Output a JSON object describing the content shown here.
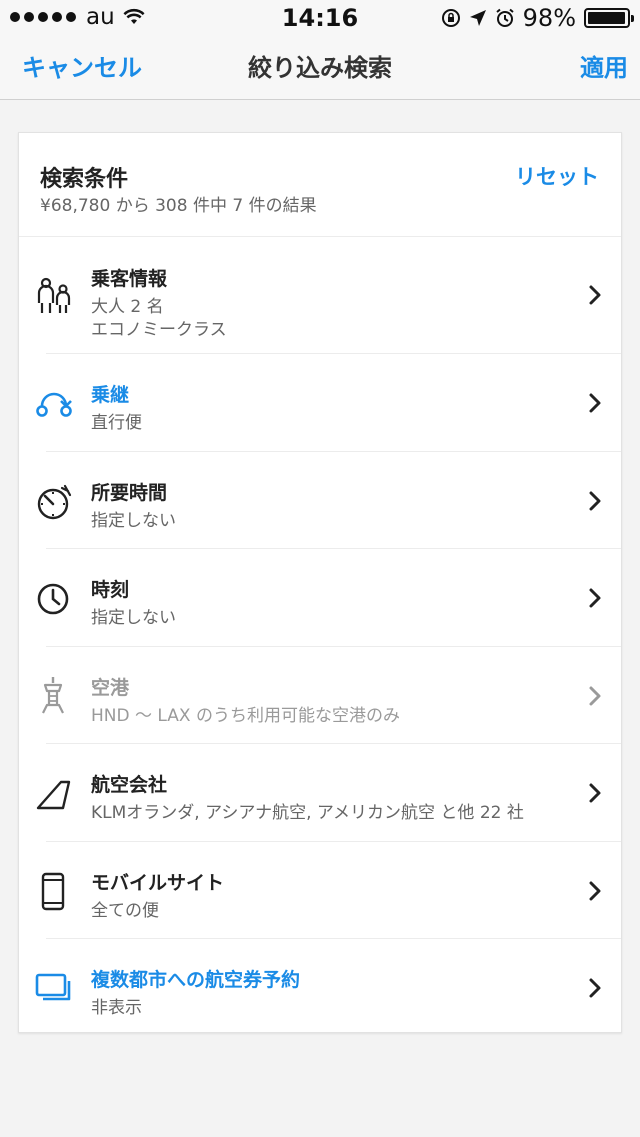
{
  "status_bar": {
    "carrier": "au",
    "time": "14:16",
    "battery": "98%",
    "battery_level": 0.98
  },
  "nav": {
    "cancel": "キャンセル",
    "title": "絞り込み検索",
    "apply": "適用"
  },
  "header": {
    "title": "検索条件",
    "summary": "¥68,780 から 308 件中 7 件の結果",
    "reset": "リセット"
  },
  "rows": [
    {
      "title": "乗客情報",
      "line1": "大人 2 名",
      "line2": "エコノミークラス",
      "icon": "passengers-icon"
    },
    {
      "title": "乗継",
      "line1": "直行便",
      "icon": "connection-icon"
    },
    {
      "title": "所要時間",
      "line1": "指定しない",
      "icon": "duration-timer-icon"
    },
    {
      "title": "時刻",
      "line1": "指定しない",
      "icon": "clock-icon"
    },
    {
      "title": "空港",
      "line1": "HND 〜 LAX のうち利用可能な空港のみ",
      "icon": "airport-tower-icon"
    },
    {
      "title": "航空会社",
      "line1": "KLMオランダ, アシアナ航空, アメリカン航空 と他 22 社",
      "icon": "airline-tail-icon"
    },
    {
      "title": "モバイルサイト",
      "line1": "全ての便",
      "icon": "mobile-phone-icon"
    },
    {
      "title": "複数都市への航空券予約",
      "line1": "非表示",
      "icon": "multi-city-icon"
    }
  ],
  "colors": {
    "accent": "#1a8be6",
    "disabled": "#9a9a9a"
  }
}
